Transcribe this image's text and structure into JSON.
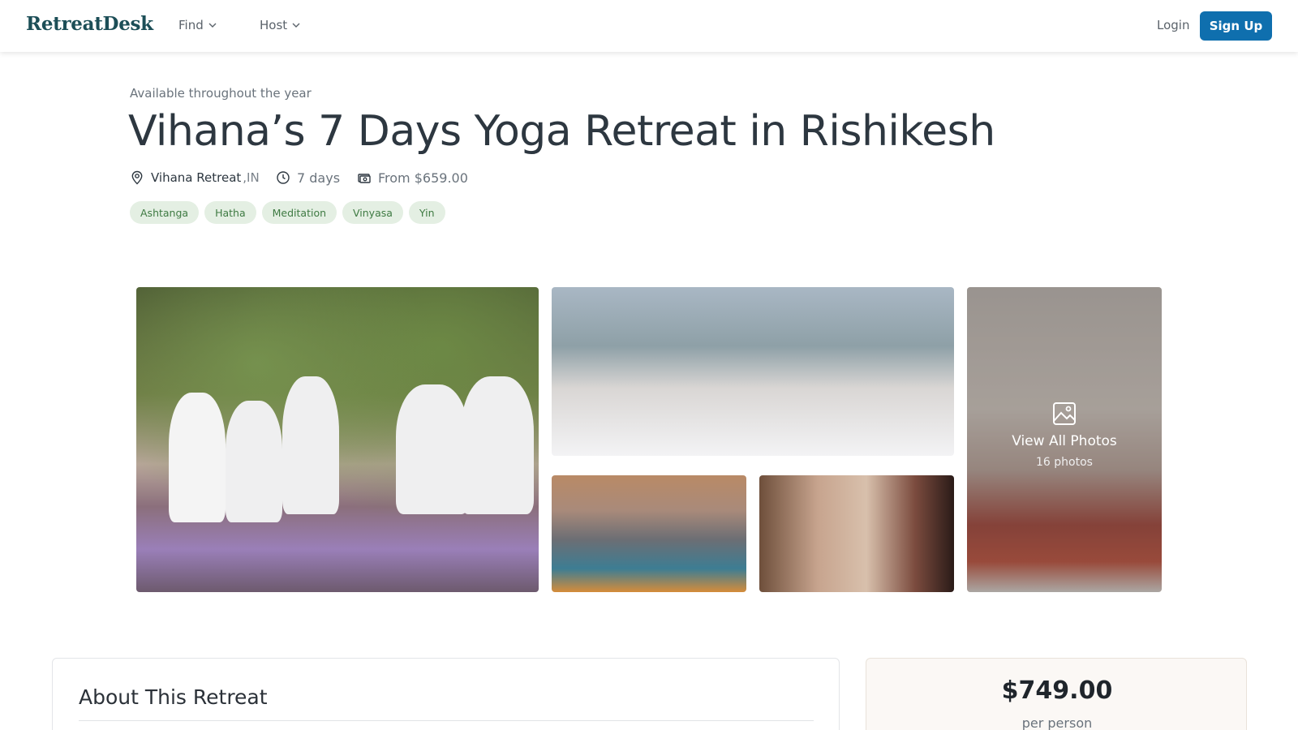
{
  "nav": {
    "logo": "RetreatDesk",
    "menus": [
      {
        "label": "Find",
        "icon": "chevron-down-icon"
      },
      {
        "label": "Host",
        "icon": "chevron-down-icon"
      }
    ],
    "login_label": "Login",
    "signup_label": "Sign Up",
    "accent_color": "#0f6fae"
  },
  "header": {
    "availability": "Available throughout the year",
    "title": "Vihana’s 7 Days Yoga Retreat in Rishikesh",
    "location_name": "Vihana Retreat",
    "location_country": ",IN",
    "location_icon": "map-pin-icon",
    "duration": "7 days",
    "duration_icon": "clock-icon",
    "price_from": "From $659.00",
    "price_icon": "money-icon"
  },
  "tags": [
    "Ashtanga",
    "Hatha",
    "Meditation",
    "Vinyasa",
    "Yin"
  ],
  "gallery": {
    "view_all_label": "View All Photos",
    "photo_count": "16 photos",
    "view_all_icon": "image-icon"
  },
  "about": {
    "title": "About This Retreat"
  },
  "booking": {
    "price": "$749.00",
    "per": "per person"
  }
}
